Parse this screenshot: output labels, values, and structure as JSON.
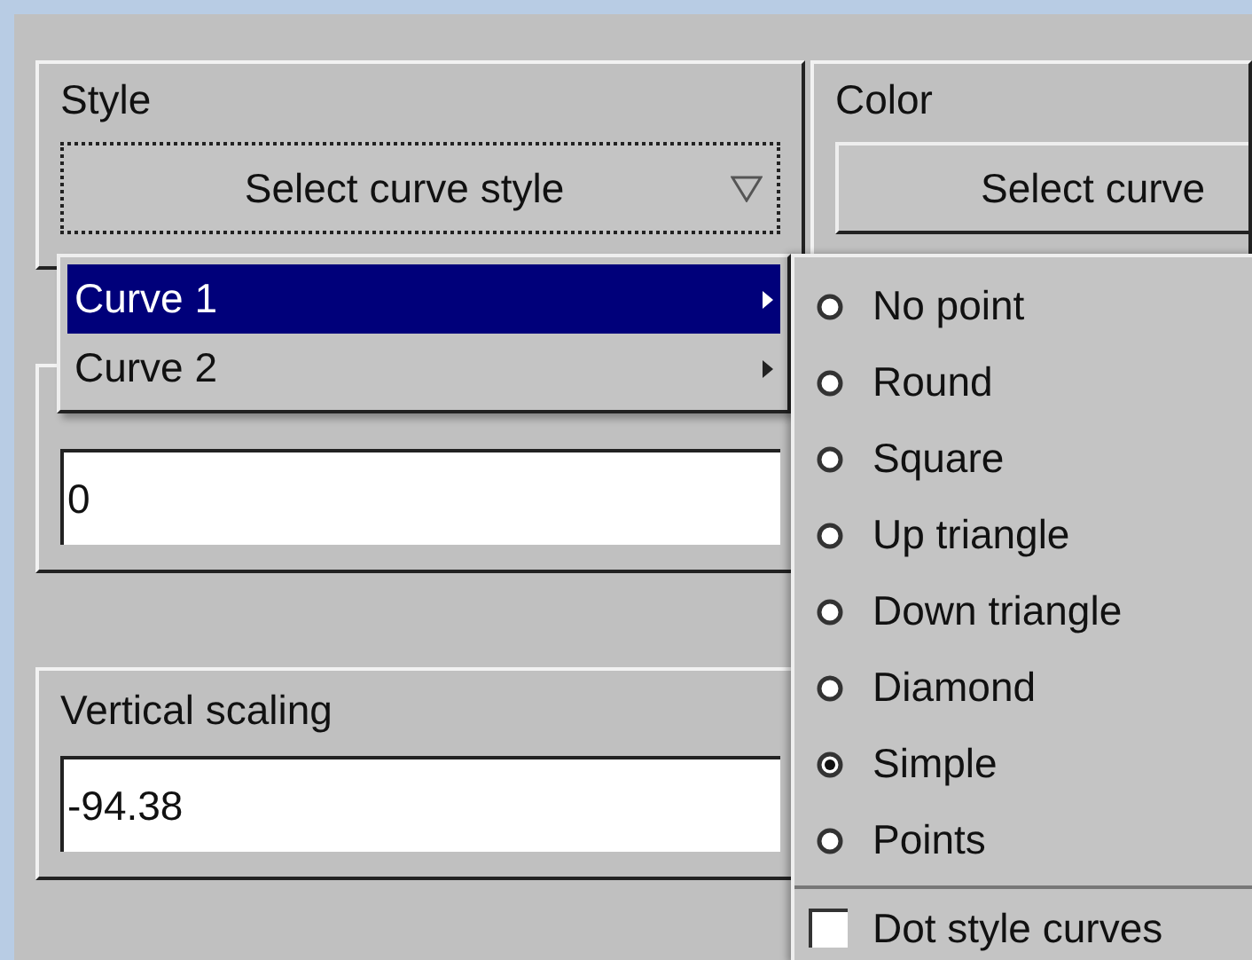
{
  "style_group": {
    "label": "Style",
    "dropdown": {
      "label": "Select curve style",
      "focused": true
    }
  },
  "color_group": {
    "label": "Color",
    "button": {
      "label": "Select curve"
    }
  },
  "horizontal_scaling": {
    "value": "0"
  },
  "vertical_scaling": {
    "label": "Vertical scaling",
    "value": "-94.38"
  },
  "curve_menu": {
    "items": [
      {
        "label": "Curve 1",
        "selected": true
      },
      {
        "label": "Curve 2",
        "selected": false
      }
    ]
  },
  "style_submenu": {
    "options": [
      {
        "label": "No point",
        "selected": false
      },
      {
        "label": "Round",
        "selected": false
      },
      {
        "label": "Square",
        "selected": false
      },
      {
        "label": "Up triangle",
        "selected": false
      },
      {
        "label": "Down triangle",
        "selected": false
      },
      {
        "label": "Diamond",
        "selected": false
      },
      {
        "label": "Simple",
        "selected": true
      },
      {
        "label": "Points",
        "selected": false
      }
    ],
    "dot_style": {
      "label": "Dot style curves",
      "checked": false
    }
  }
}
